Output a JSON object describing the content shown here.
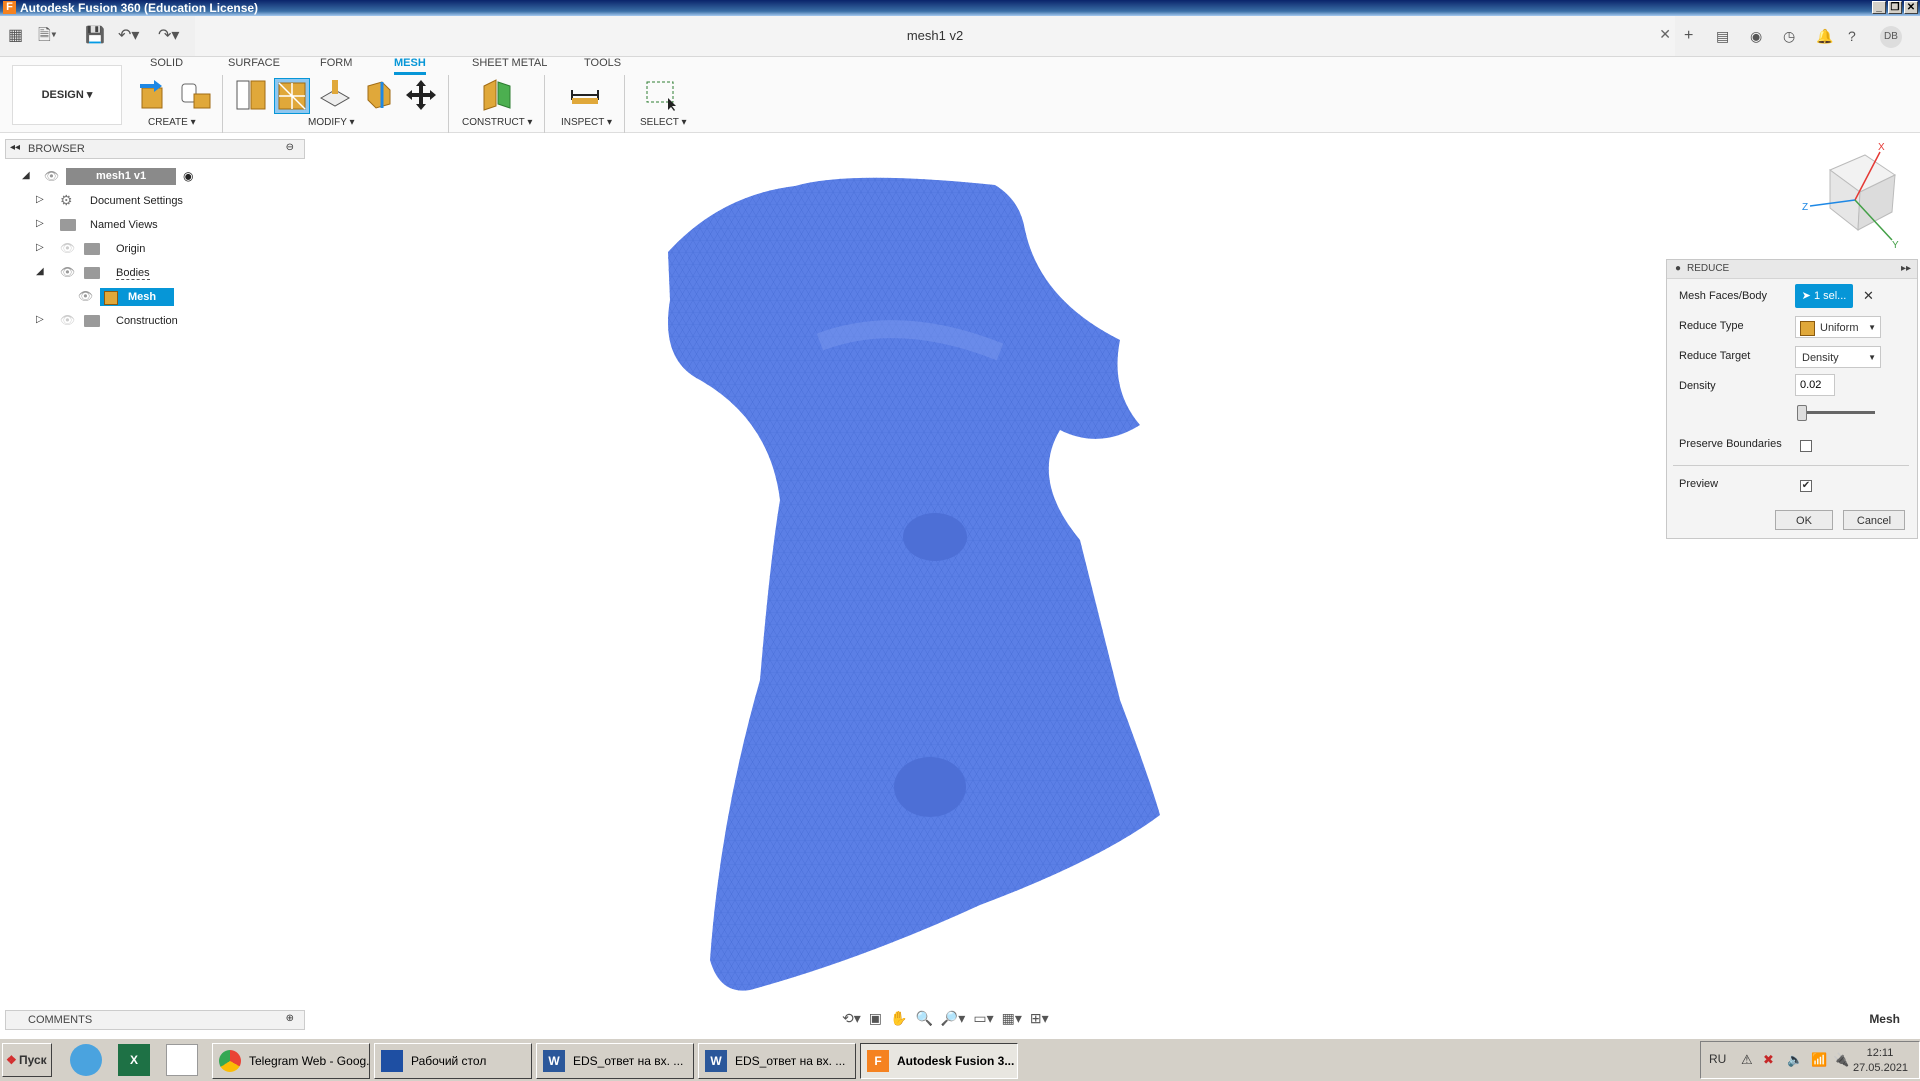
{
  "window": {
    "title": "Autodesk Fusion 360 (Education License)",
    "doc_name": "mesh1 v2",
    "user_initials": "DB"
  },
  "ribbon": {
    "design_label": "DESIGN",
    "tabs": [
      "SOLID",
      "SURFACE",
      "FORM",
      "MESH",
      "SHEET METAL",
      "TOOLS"
    ],
    "groups": {
      "create": "CREATE",
      "modify": "MODIFY",
      "construct": "CONSTRUCT",
      "inspect": "INSPECT",
      "select": "SELECT"
    }
  },
  "browser": {
    "title": "BROWSER",
    "root": "mesh1 v1",
    "items": [
      "Document Settings",
      "Named Views",
      "Origin",
      "Bodies",
      "Mesh",
      "Construction"
    ]
  },
  "reduce_panel": {
    "title": "REDUCE",
    "mesh_faces_label": "Mesh Faces/Body",
    "selection": "1 sel...",
    "reduce_type_label": "Reduce Type",
    "reduce_type_value": "Uniform",
    "reduce_target_label": "Reduce Target",
    "reduce_target_value": "Density",
    "density_label": "Density",
    "density_value": "0.02",
    "preserve_label": "Preserve Boundaries",
    "preserve_checked": false,
    "preview_label": "Preview",
    "preview_checked": true,
    "ok_label": "OK",
    "cancel_label": "Cancel"
  },
  "bottom": {
    "comments": "COMMENTS",
    "mode_label": "Mesh"
  },
  "taskbar": {
    "start": "Пуск",
    "buttons": [
      "Telegram Web - Goog...",
      "Рабочий стол",
      "EDS_ответ на вх. ...",
      "EDS_ответ на вх. ...",
      "Autodesk Fusion 3..."
    ],
    "lang": "RU",
    "time": "12:11",
    "date": "27.05.2021"
  },
  "colors": {
    "accent": "#0696d7",
    "mesh": "#5b7fe6"
  }
}
